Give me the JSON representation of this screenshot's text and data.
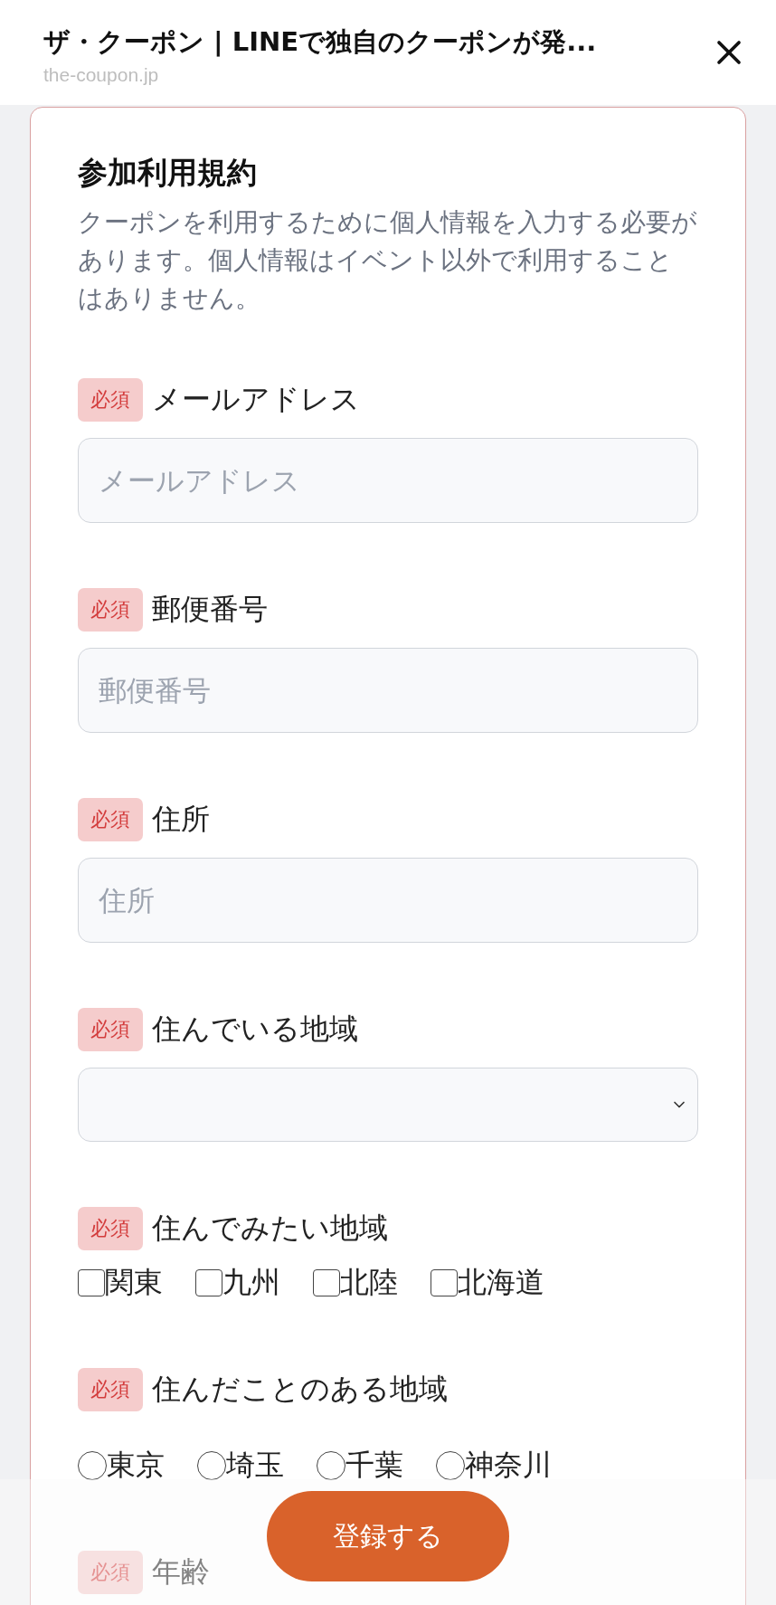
{
  "header": {
    "title": "ザ・クーポン | LINEで独自のクーポンが発...",
    "url": "the-coupon.jp"
  },
  "form": {
    "title": "参加利用規約",
    "description": "クーポンを利用するために個人情報を入力する必要があります。個人情報はイベント以外で利用することはありません。",
    "fields": [
      {
        "kind": "text",
        "badge": "必須",
        "label": "メールアドレス",
        "placeholder": "メールアドレス"
      },
      {
        "kind": "text",
        "badge": "必須",
        "label": "郵便番号",
        "placeholder": "郵便番号"
      },
      {
        "kind": "text",
        "badge": "必須",
        "label": "住所",
        "placeholder": "住所"
      },
      {
        "kind": "select",
        "badge": "必須",
        "label": "住んでいる地域"
      },
      {
        "kind": "checkbox",
        "badge": "必須",
        "label": "住んでみたい地域",
        "options": [
          {
            "label": "関東",
            "checked": false
          },
          {
            "label": "九州",
            "checked": false
          },
          {
            "label": "北陸",
            "checked": false
          },
          {
            "label": "北海道",
            "checked": false
          }
        ]
      },
      {
        "kind": "radio",
        "badge": "必須",
        "label": "住んだことのある地域",
        "options": [
          {
            "label": "東京",
            "selected": false
          },
          {
            "label": "埼玉",
            "selected": false
          },
          {
            "label": "千葉",
            "selected": false
          },
          {
            "label": "神奈川",
            "selected": false
          }
        ]
      },
      {
        "kind": "heading",
        "badge": "必須",
        "label": "年齢"
      }
    ]
  },
  "submit_button": "登録する"
}
